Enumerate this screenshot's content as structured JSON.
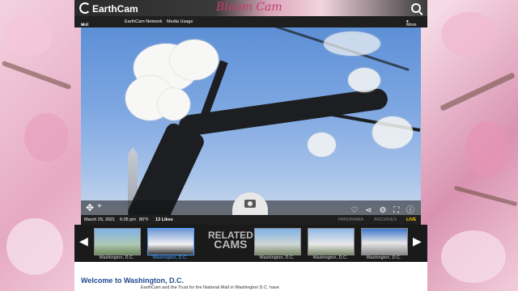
{
  "header": {
    "logo_text": "EarthCam",
    "brand_text": "Bloom Cam"
  },
  "nav": {
    "items": [
      "Hall of Fame",
      "EarthCam Network",
      "Media Usage"
    ],
    "more_label": "More"
  },
  "info": {
    "date": "March 29, 2021",
    "time": "6:05 pm",
    "temp": "80°F",
    "likes": "13 Likes",
    "tab_panorama": "PANORAMA",
    "tab_archives": "ARCHIVES",
    "tab_live": "LIVE"
  },
  "related": {
    "label_top": "RELATED",
    "label_bottom": "CAMS",
    "thumbs": [
      {
        "caption": "Washington, D.C."
      },
      {
        "caption": "Washington, D.C."
      },
      {
        "caption": "Washington, D.C."
      },
      {
        "caption": "Washington, D.C."
      },
      {
        "caption": "Washington, D.C."
      }
    ]
  },
  "welcome": {
    "title": "Welcome to Washington, D.C.",
    "snippet": "EarthCam and the Trust for the National Mall in Washington D.C. have"
  },
  "icons": [
    "search-icon",
    "star-icon",
    "move-icon",
    "zoom-in-icon",
    "camera-icon",
    "heart-icon",
    "share-icon",
    "settings-icon",
    "fullscreen-icon",
    "info-icon",
    "arrow-left-icon",
    "arrow-right-icon"
  ],
  "colors": {
    "brand": "#c83a72",
    "live": "#ffd400",
    "active_link": "#4aa3ff"
  }
}
